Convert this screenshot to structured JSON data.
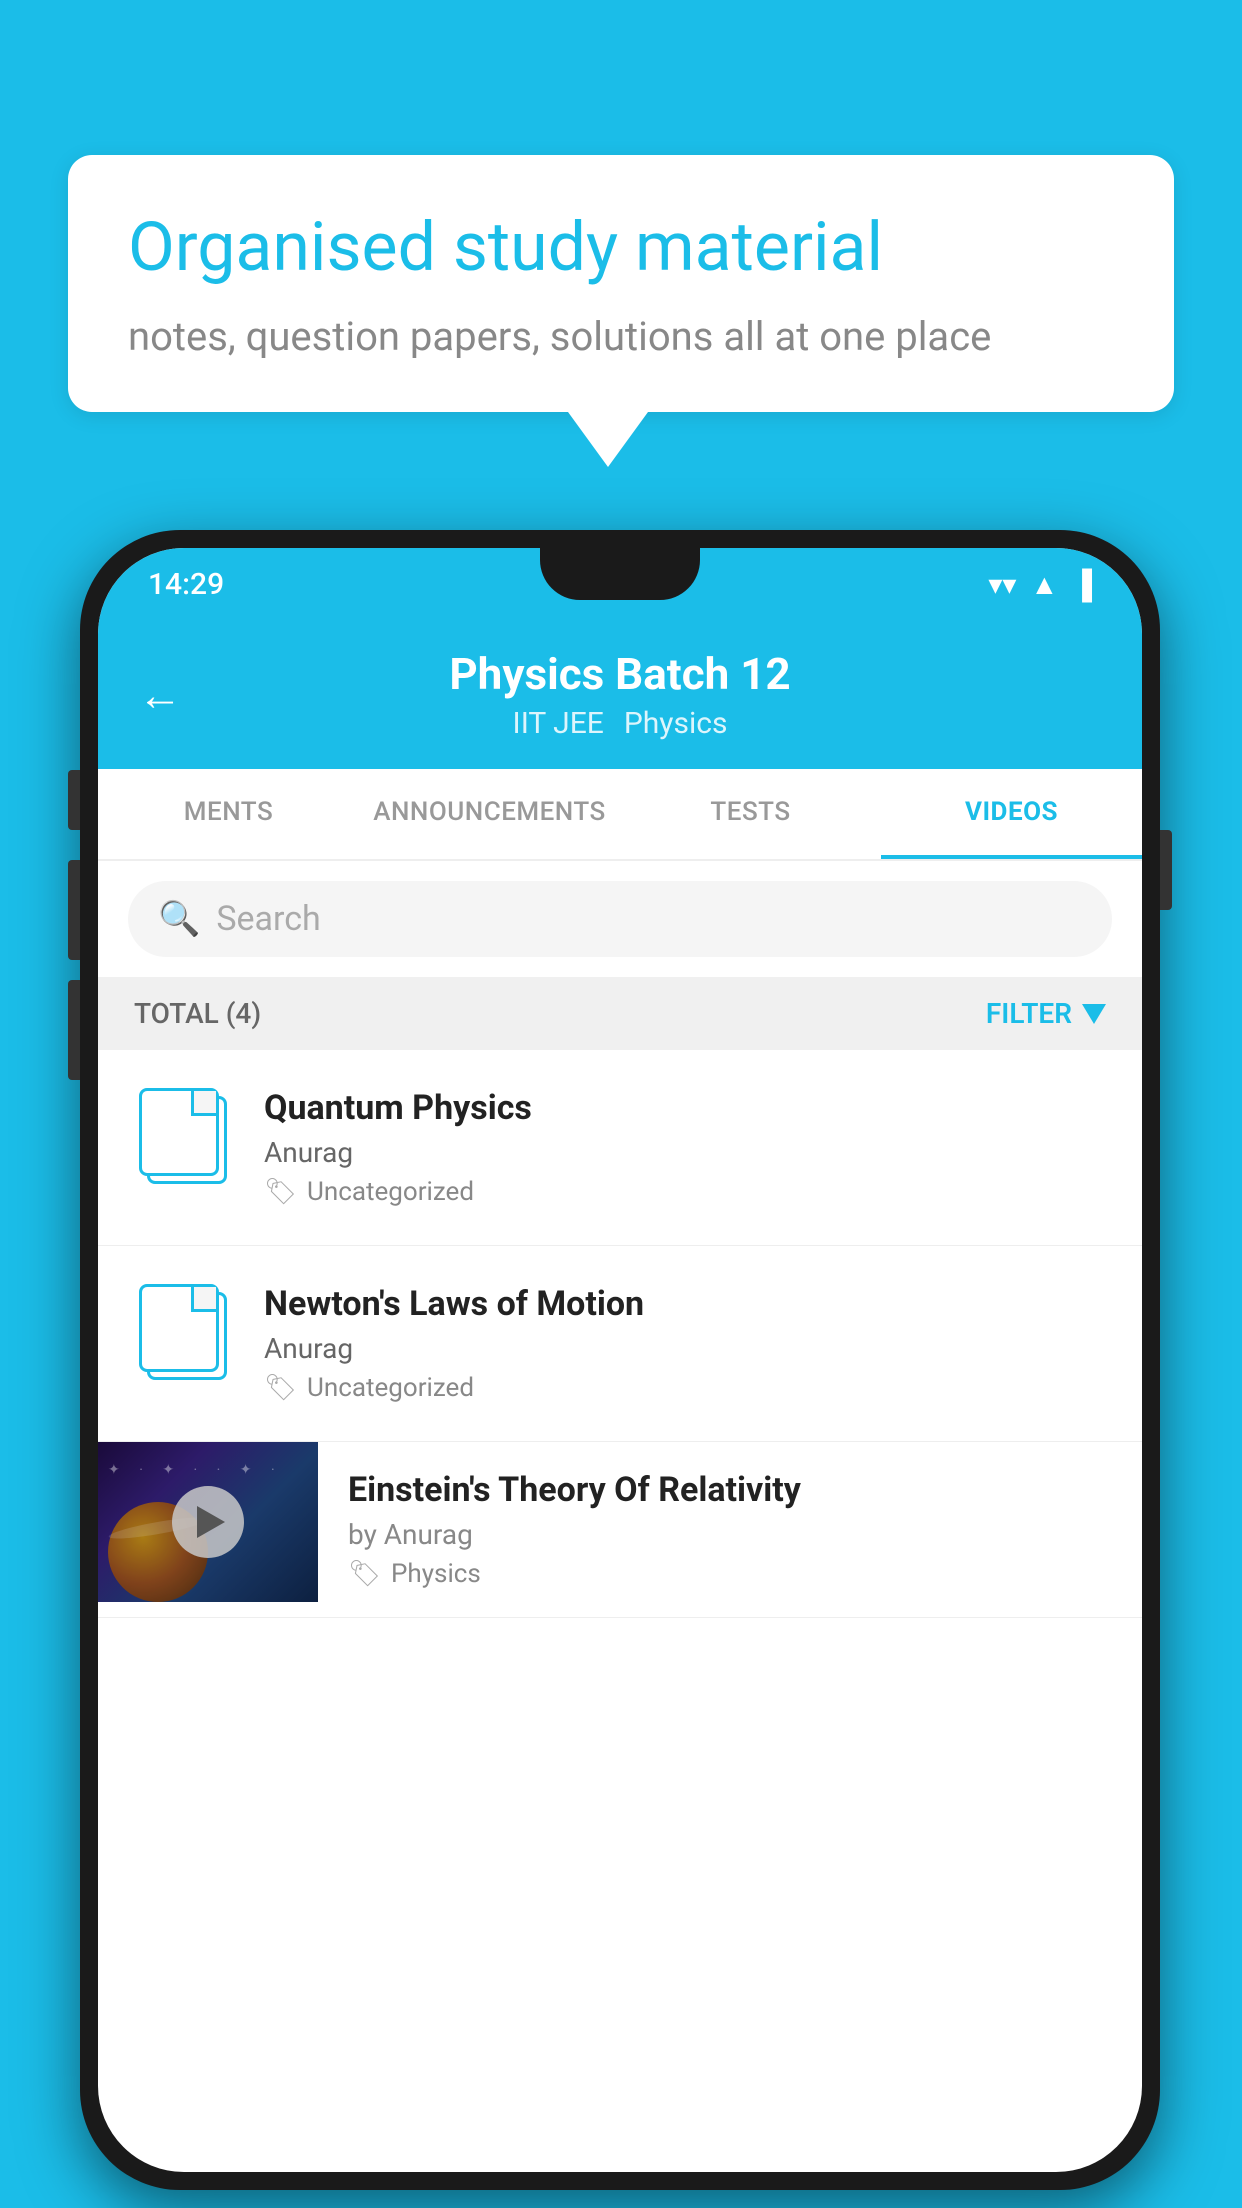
{
  "background": {
    "color": "#1BBDE8"
  },
  "speech_bubble": {
    "title": "Organised study material",
    "subtitle": "notes, question papers, solutions all at one place"
  },
  "phone": {
    "status_bar": {
      "time": "14:29"
    },
    "header": {
      "title": "Physics Batch 12",
      "tags": [
        "IIT JEE",
        "Physics"
      ],
      "back_label": "←"
    },
    "tabs": [
      {
        "label": "MENTS",
        "active": false
      },
      {
        "label": "ANNOUNCEMENTS",
        "active": false
      },
      {
        "label": "TESTS",
        "active": false
      },
      {
        "label": "VIDEOS",
        "active": true
      }
    ],
    "search": {
      "placeholder": "Search"
    },
    "filter": {
      "total_label": "TOTAL (4)",
      "filter_label": "FILTER"
    },
    "videos": [
      {
        "title": "Quantum Physics",
        "author": "Anurag",
        "tag": "Uncategorized",
        "type": "file",
        "has_thumbnail": false
      },
      {
        "title": "Newton's Laws of Motion",
        "author": "Anurag",
        "tag": "Uncategorized",
        "type": "file",
        "has_thumbnail": false
      },
      {
        "title": "Einstein's Theory Of Relativity",
        "author": "by Anurag",
        "tag": "Physics",
        "type": "video",
        "has_thumbnail": true
      }
    ]
  }
}
